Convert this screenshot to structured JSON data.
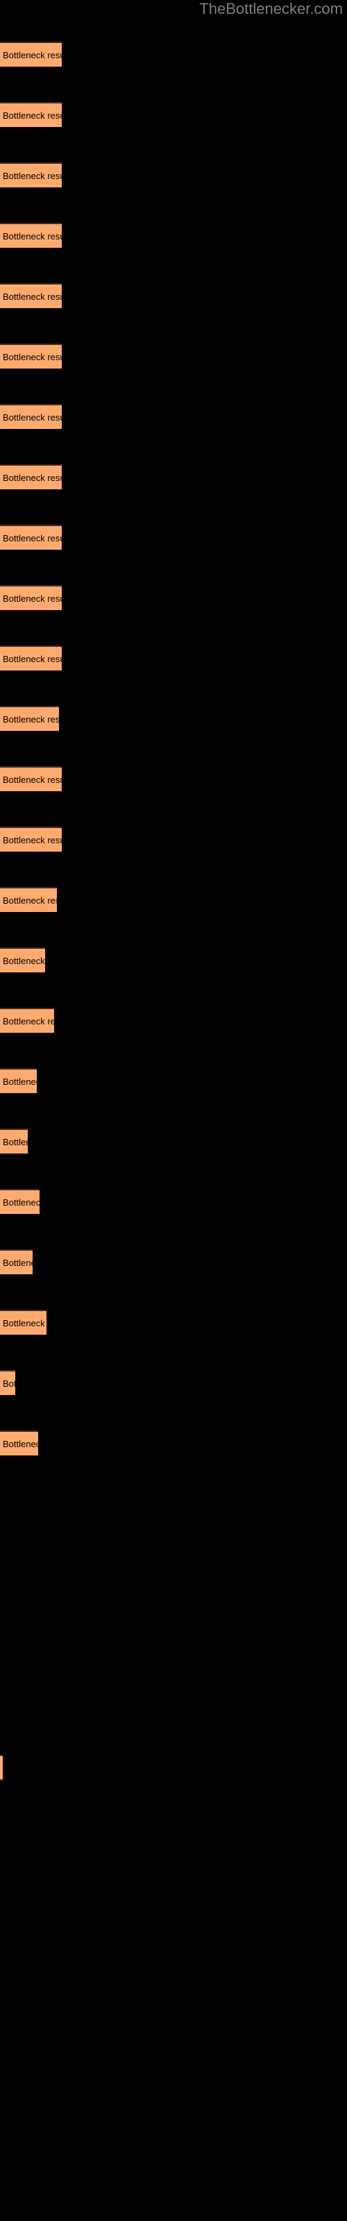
{
  "watermark": {
    "text": "TheBottlenecker.com",
    "color": "#808080"
  },
  "colors": {
    "background": "#000000",
    "bar_fill": "#FFAB70",
    "bar_edge": "#4A2A18",
    "label_text": "#000000"
  },
  "chart_data": {
    "type": "bar",
    "orientation": "horizontal",
    "title": "",
    "subtitle": "",
    "xlabel": "",
    "ylabel": "",
    "grid": false,
    "legend": false,
    "bar_label_text": "Bottleneck result",
    "categories": [
      "Bottleneck result",
      "Bottleneck result",
      "Bottleneck result",
      "Bottleneck result",
      "Bottleneck result",
      "Bottleneck result",
      "Bottleneck result",
      "Bottleneck result",
      "Bottleneck result",
      "Bottleneck result",
      "Bottleneck result",
      "Bottleneck result",
      "Bottleneck result",
      "Bottleneck result",
      "Bottleneck result",
      "Bottleneck result",
      "Bottleneck result",
      "Bottleneck result",
      "Bottleneck result",
      "Bottleneck result",
      "Bottleneck result",
      "Bottleneck result",
      "Bottleneck result",
      "Bottleneck result"
    ],
    "values": [
      89,
      89,
      89,
      89,
      89,
      89,
      89,
      89,
      89,
      89,
      89,
      85,
      89,
      89,
      82,
      65,
      78,
      53,
      40,
      57,
      47,
      67,
      22,
      55
    ],
    "xlim": [
      0,
      500
    ],
    "bars": [
      {
        "y": 60,
        "width": 89,
        "label": "Bottleneck result"
      },
      {
        "y": 147,
        "width": 89,
        "label": "Bottleneck result"
      },
      {
        "y": 234,
        "width": 89,
        "label": "Bottleneck result"
      },
      {
        "y": 321,
        "width": 89,
        "label": "Bottleneck result"
      },
      {
        "y": 408,
        "width": 89,
        "label": "Bottleneck result"
      },
      {
        "y": 495,
        "width": 89,
        "label": "Bottleneck result"
      },
      {
        "y": 582,
        "width": 89,
        "label": "Bottleneck result"
      },
      {
        "y": 669,
        "width": 89,
        "label": "Bottleneck result"
      },
      {
        "y": 756,
        "width": 89,
        "label": "Bottleneck result"
      },
      {
        "y": 843,
        "width": 89,
        "label": "Bottleneck result"
      },
      {
        "y": 930,
        "width": 89,
        "label": "Bottleneck result"
      },
      {
        "y": 1017,
        "width": 85,
        "label": "Bottleneck result"
      },
      {
        "y": 1104,
        "width": 89,
        "label": "Bottleneck result"
      },
      {
        "y": 1191,
        "width": 89,
        "label": "Bottleneck result"
      },
      {
        "y": 1278,
        "width": 82,
        "label": "Bottleneck result"
      },
      {
        "y": 1365,
        "width": 65,
        "label": "Bottleneck result"
      },
      {
        "y": 1452,
        "width": 78,
        "label": "Bottleneck result"
      },
      {
        "y": 1539,
        "width": 53,
        "label": "Bottleneck result"
      },
      {
        "y": 1626,
        "width": 40,
        "label": "Bottleneck result"
      },
      {
        "y": 1713,
        "width": 57,
        "label": "Bottleneck result"
      },
      {
        "y": 1800,
        "width": 47,
        "label": "Bottleneck result"
      },
      {
        "y": 1887,
        "width": 67,
        "label": "Bottleneck result"
      },
      {
        "y": 1974,
        "width": 22,
        "label": "Bottleneck result"
      },
      {
        "y": 2061,
        "width": 55,
        "label": "Bottleneck result"
      }
    ],
    "sliver": {
      "y": 2528,
      "width": 4,
      "height": 36
    }
  }
}
